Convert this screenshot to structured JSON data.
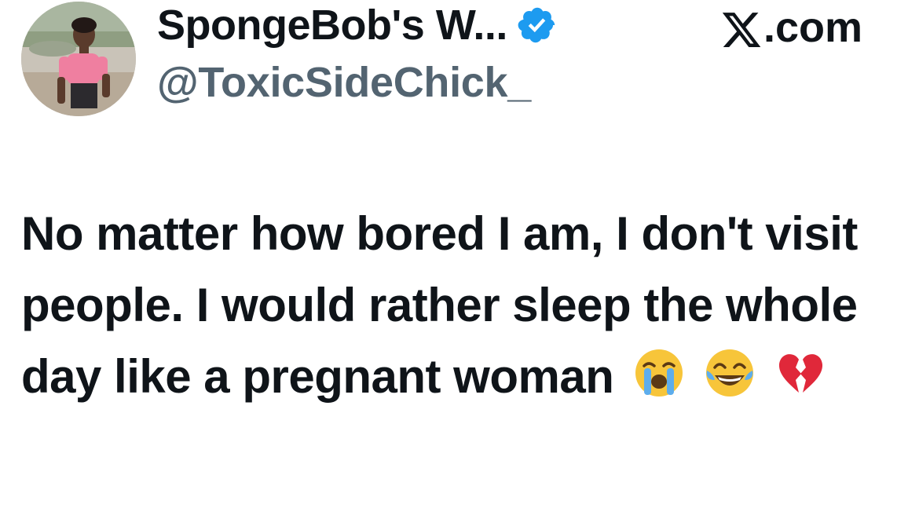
{
  "author": {
    "display_name": "SpongeBob's W...",
    "handle": "@ToxicSideChick_",
    "verified_icon": "verified-badge-icon",
    "avatar_icon": "profile-avatar",
    "verified_color": "#1d9bf0"
  },
  "brand": {
    "logo_icon": "x-logo-icon",
    "suffix": ".com"
  },
  "tweet": {
    "text": "No matter how bored I am, I don't visit people. I would rather sleep the whole day like a pregnant woman",
    "emojis": [
      "loudly-crying-face-emoji",
      "face-with-tears-of-joy-emoji",
      "broken-heart-emoji"
    ]
  },
  "colors": {
    "text_primary": "#0f1419",
    "text_secondary": "#536471",
    "background": "#ffffff"
  }
}
